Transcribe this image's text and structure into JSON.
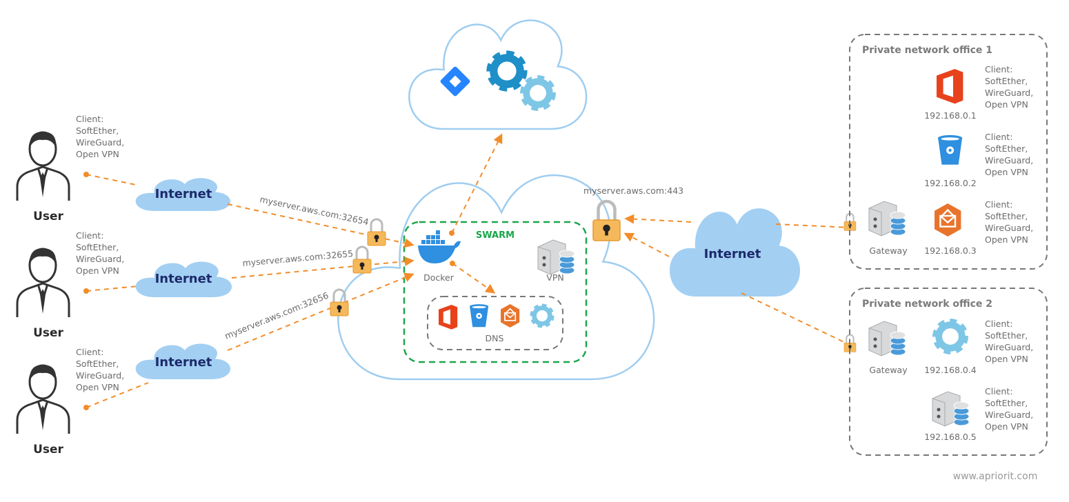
{
  "colors": {
    "accent_line": "#f28c28",
    "cloud_fill": "#a3cff2",
    "cloud_outline": "#9fcdf0",
    "swarm": "#1aa64b",
    "lock": "#f5b85a"
  },
  "users": [
    {
      "label": "User",
      "client": [
        "Client:",
        "SoftEther,",
        "WireGuard,",
        "Open VPN"
      ],
      "internet": "Internet",
      "endpoint": "myserver.aws.com:32654"
    },
    {
      "label": "User",
      "client": [
        "Client:",
        "SoftEther,",
        "WireGuard,",
        "Open VPN"
      ],
      "internet": "Internet",
      "endpoint": "myserver.aws.com:32655"
    },
    {
      "label": "User",
      "client": [
        "Client:",
        "SoftEther,",
        "WireGuard,",
        "Open VPN"
      ],
      "internet": "Internet",
      "endpoint": "myserver.aws.com:32656"
    }
  ],
  "top_cloud": {
    "icons": [
      "jira-icon",
      "gear-icon",
      "gear-icon"
    ]
  },
  "server_cloud": {
    "swarm_label": "SWARM",
    "docker_label": "Docker",
    "vpn_label": "VPN",
    "dns_label": "DNS",
    "dns_icons": [
      "office-icon",
      "bitbucket-icon",
      "mail-icon",
      "gear-icon"
    ],
    "endpoint": "myserver.aws.com:443"
  },
  "right_internet": "Internet",
  "offices": [
    {
      "title": "Private network office 1",
      "gateway": "Gateway",
      "hosts": [
        {
          "ip": "192.168.0.1",
          "icon": "office-icon",
          "client": [
            "Client:",
            "SoftEther,",
            "WireGuard,",
            "Open VPN"
          ]
        },
        {
          "ip": "192.168.0.2",
          "icon": "bitbucket-icon",
          "client": [
            "Client:",
            "SoftEther,",
            "WireGuard,",
            "Open VPN"
          ]
        },
        {
          "ip": "192.168.0.3",
          "icon": "mail-icon",
          "client": [
            "Client:",
            "SoftEther,",
            "WireGuard,",
            "Open VPN"
          ]
        }
      ]
    },
    {
      "title": "Private network office 2",
      "gateway": "Gateway",
      "hosts": [
        {
          "ip": "192.168.0.4",
          "icon": "gear-icon",
          "client": [
            "Client:",
            "SoftEther,",
            "WireGuard,",
            "Open VPN"
          ]
        },
        {
          "ip": "192.168.0.5",
          "icon": "server-icon",
          "client": [
            "Client:",
            "SoftEther,",
            "WireGuard,",
            "Open VPN"
          ]
        }
      ]
    }
  ],
  "footer": "www.apriorit.com"
}
